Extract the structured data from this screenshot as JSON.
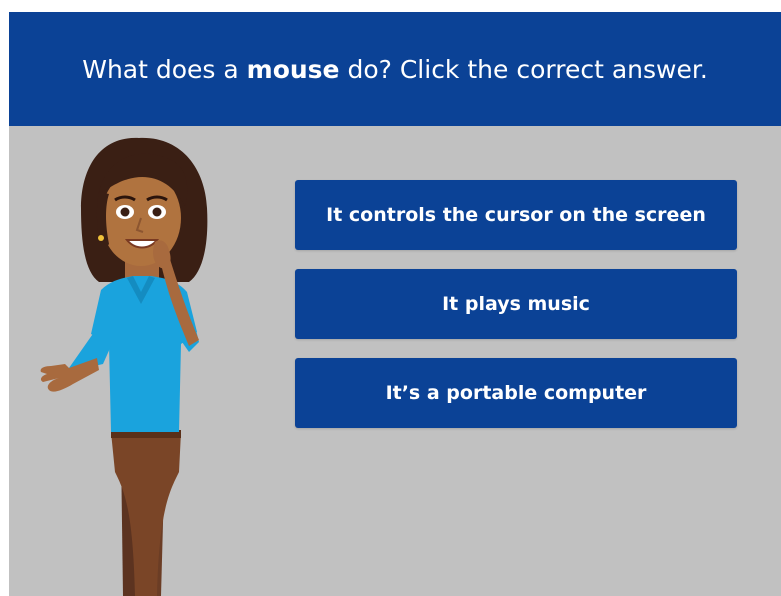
{
  "question": {
    "prefix": "What does a ",
    "emphasis": "mouse",
    "suffix": " do? Click the correct answer."
  },
  "answers": [
    {
      "label": "It controls the cursor on the screen"
    },
    {
      "label": "It plays music"
    },
    {
      "label": "It’s a portable computer"
    }
  ],
  "colors": {
    "header_bg": "#0b4296",
    "button_bg": "#0b4296",
    "slide_bg": "#c1c1c1",
    "text": "#ffffff"
  },
  "icons": {
    "character": "woman-thinking-illustration"
  }
}
